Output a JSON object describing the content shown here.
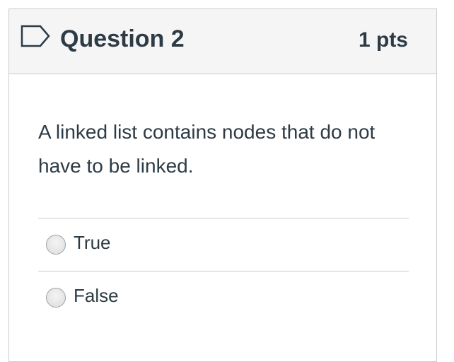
{
  "question": {
    "title": "Question 2",
    "points": "1 pts",
    "text": "A linked list contains nodes that do not have to be linked.",
    "answers": [
      {
        "label": "True",
        "selected": false
      },
      {
        "label": "False",
        "selected": false
      }
    ]
  },
  "flag_icon": "bookmark-flag-outline-icon",
  "colors": {
    "text": "#2d3b45",
    "header_bg": "#f5f5f5",
    "border": "#c7cdd1",
    "flag": "#2d3b45"
  }
}
